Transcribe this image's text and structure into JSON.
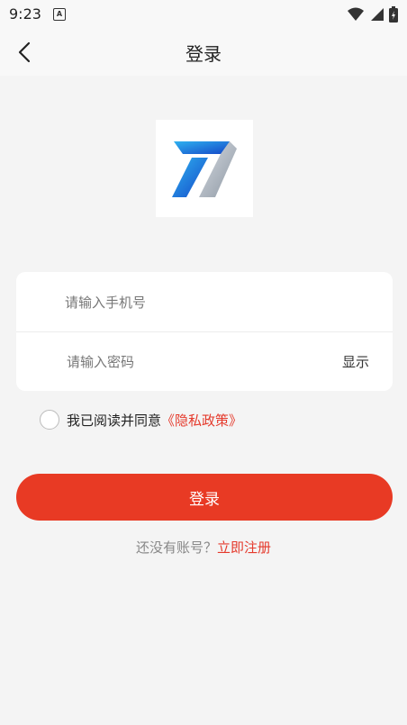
{
  "status_bar": {
    "time": "9:23",
    "notification_glyph": "A"
  },
  "nav": {
    "title": "登录"
  },
  "form": {
    "phone_placeholder": "请输入手机号",
    "password_placeholder": "请输入密码",
    "show_label": "显示"
  },
  "agreement": {
    "text": "我已阅读并同意",
    "policy_link": "《隐私政策》",
    "checked": false
  },
  "login_button": "登录",
  "register": {
    "prompt": "还没有账号？",
    "link": "立即注册"
  },
  "colors": {
    "accent": "#e83a24",
    "link": "#e53a2c",
    "background": "#f4f4f4"
  },
  "icons": [
    "back-arrow-icon",
    "wifi-icon",
    "signal-icon",
    "battery-icon",
    "app-logo-icon"
  ]
}
